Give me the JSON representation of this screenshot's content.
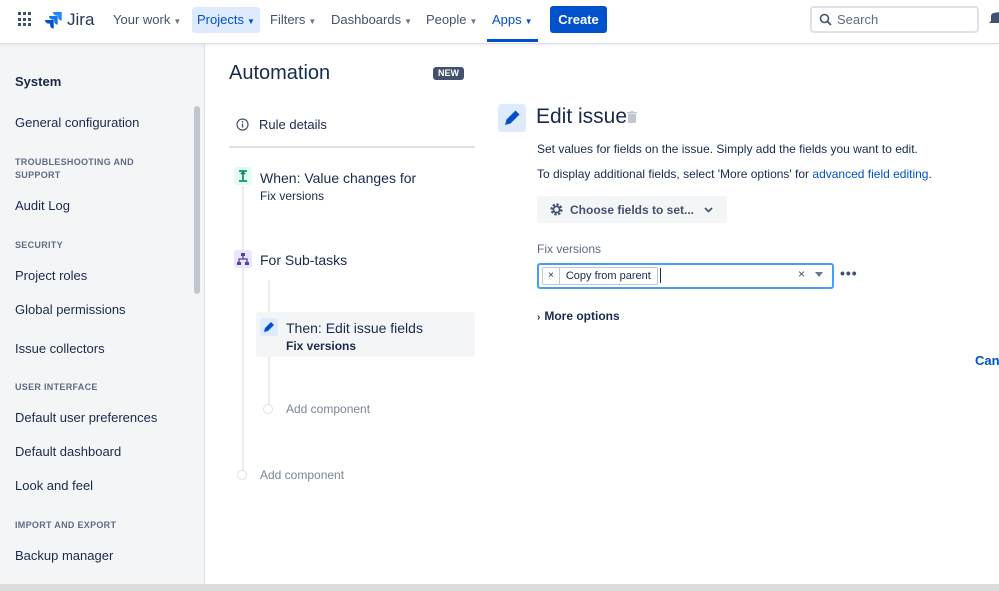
{
  "nav": {
    "brand": "Jira",
    "items": [
      {
        "label": "Your work"
      },
      {
        "label": "Projects"
      },
      {
        "label": "Filters"
      },
      {
        "label": "Dashboards"
      },
      {
        "label": "People"
      },
      {
        "label": "Apps"
      }
    ],
    "create_label": "Create",
    "search_placeholder": "Search"
  },
  "sidebar": {
    "title": "System",
    "links": {
      "general": "General configuration",
      "audit": "Audit Log",
      "roles": "Project roles",
      "global": "Global permissions",
      "collectors": "Issue collectors",
      "prefs": "Default user preferences",
      "dashboard": "Default dashboard",
      "look": "Look and feel",
      "backup": "Backup manager"
    },
    "headings": {
      "troubleshooting": "TROUBLESHOOTING AND SUPPORT",
      "security": "SECURITY",
      "ui": "USER INTERFACE",
      "import": "IMPORT AND EXPORT"
    }
  },
  "automation": {
    "title": "Automation",
    "badge": "NEW",
    "rule_details": "Rule details",
    "trigger": {
      "title": "When: Value changes for",
      "sub": "Fix versions"
    },
    "branch": {
      "title": "For Sub-tasks"
    },
    "action": {
      "title": "Then: Edit issue fields",
      "sub": "Fix versions"
    },
    "add_component": "Add component"
  },
  "edit": {
    "title": "Edit issue",
    "desc1": "Set values for fields on the issue. Simply add the fields you want to edit.",
    "desc2_prefix": "To display additional fields, select 'More options' for ",
    "desc2_link": "advanced field editing",
    "desc2_suffix": ".",
    "choose_label": "Choose fields to set...",
    "field_label": "Fix versions",
    "chip_value": "Copy from parent",
    "more_options": "More options",
    "cancel": "Canc"
  },
  "colors": {
    "accent": "#0052CC",
    "trigger_icon_bg": "#E3FCEF",
    "branch_icon_bg": "#EAE6FF"
  }
}
